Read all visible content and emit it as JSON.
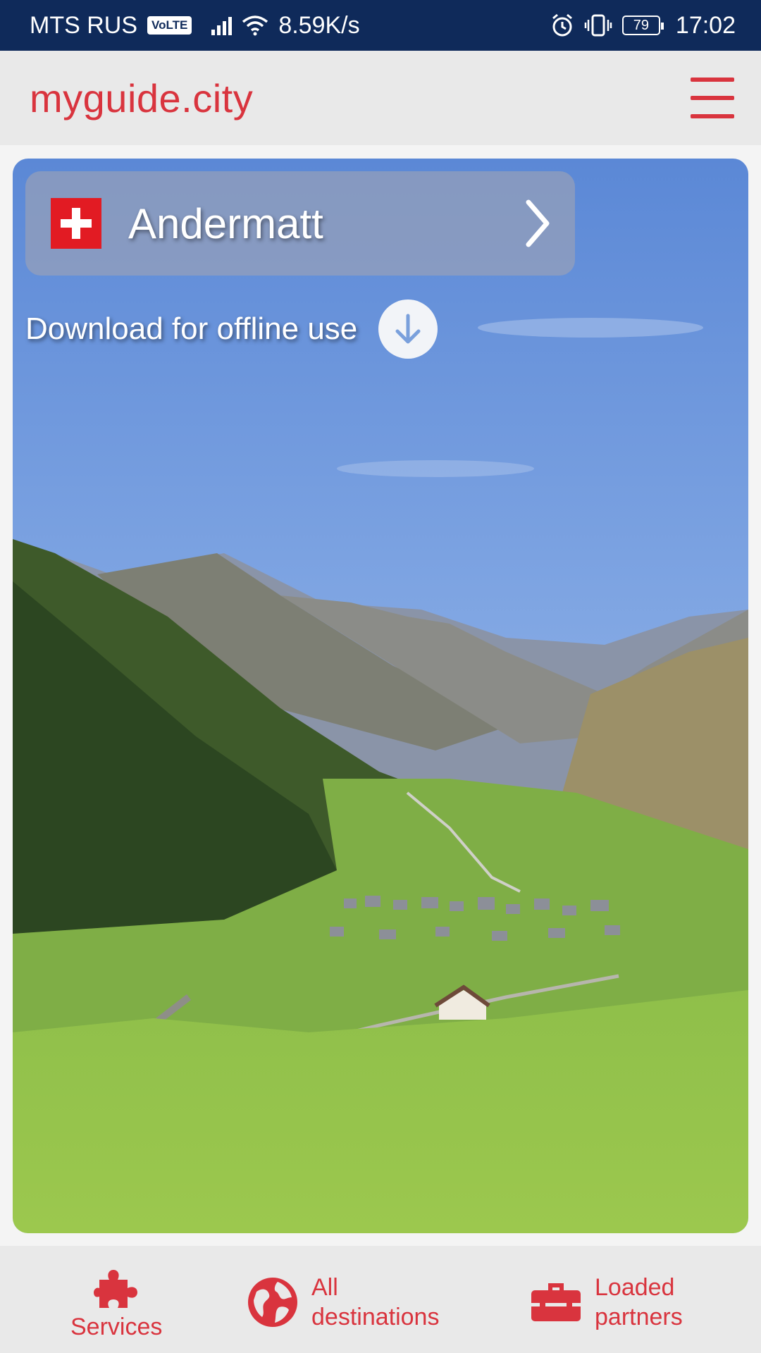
{
  "status_bar": {
    "carrier": "MTS RUS",
    "volte": "VoLTE",
    "speed": "8.59K/s",
    "battery": "79",
    "time": "17:02"
  },
  "header": {
    "brand": "myguide.city",
    "menu_icon": "hamburger-menu-icon"
  },
  "hero": {
    "city": "Andermatt",
    "country_flag": "switzerland-flag-icon",
    "download_label": "Download for offline use",
    "download_icon": "download-arrow-icon"
  },
  "bottom_nav": {
    "services": "Services",
    "destinations_line1": "All",
    "destinations_line2": "destinations",
    "partners_line1": "Loaded",
    "partners_line2": "partners"
  },
  "colors": {
    "accent": "#d9343e",
    "status_bar": "#0f2a5a",
    "appbar": "#e9e9e9"
  }
}
